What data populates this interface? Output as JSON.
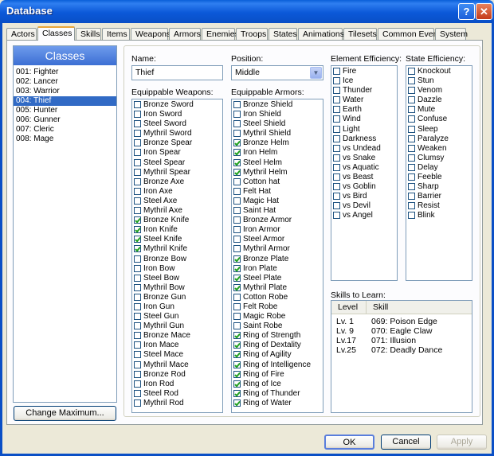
{
  "window": {
    "title": "Database"
  },
  "tabs": [
    "Actors",
    "Classes",
    "Skills",
    "Items",
    "Weapons",
    "Armors",
    "Enemies",
    "Troops",
    "States",
    "Animations",
    "Tilesets",
    "Common Events",
    "System"
  ],
  "classes": {
    "header": "Classes",
    "items": [
      "001: Fighter",
      "002: Lancer",
      "003: Warrior",
      "004: Thief",
      "005: Hunter",
      "006: Gunner",
      "007: Cleric",
      "008: Mage"
    ],
    "selected_index": 3,
    "change_max_label": "Change Maximum..."
  },
  "form": {
    "name_label": "Name:",
    "name_value": "Thief",
    "position_label": "Position:",
    "position_value": "Middle",
    "weapons_label": "Equippable Weapons:",
    "armors_label": "Equippable Armors:",
    "element_label": "Element Efficiency:",
    "state_label": "State Efficiency:",
    "skills_label": "Skills to Learn:"
  },
  "weapons": [
    {
      "name": "Bronze Sword",
      "checked": false
    },
    {
      "name": "Iron Sword",
      "checked": false
    },
    {
      "name": "Steel Sword",
      "checked": false
    },
    {
      "name": "Mythril Sword",
      "checked": false
    },
    {
      "name": "Bronze Spear",
      "checked": false
    },
    {
      "name": "Iron Spear",
      "checked": false
    },
    {
      "name": "Steel Spear",
      "checked": false
    },
    {
      "name": "Mythril Spear",
      "checked": false
    },
    {
      "name": "Bronze Axe",
      "checked": false
    },
    {
      "name": "Iron Axe",
      "checked": false
    },
    {
      "name": "Steel Axe",
      "checked": false
    },
    {
      "name": "Mythril Axe",
      "checked": false
    },
    {
      "name": "Bronze Knife",
      "checked": true
    },
    {
      "name": "Iron Knife",
      "checked": true
    },
    {
      "name": "Steel Knife",
      "checked": true
    },
    {
      "name": "Mythril Knife",
      "checked": true
    },
    {
      "name": "Bronze Bow",
      "checked": false
    },
    {
      "name": "Iron Bow",
      "checked": false
    },
    {
      "name": "Steel Bow",
      "checked": false
    },
    {
      "name": "Mythril Bow",
      "checked": false
    },
    {
      "name": "Bronze Gun",
      "checked": false
    },
    {
      "name": "Iron Gun",
      "checked": false
    },
    {
      "name": "Steel Gun",
      "checked": false
    },
    {
      "name": "Mythril Gun",
      "checked": false
    },
    {
      "name": "Bronze Mace",
      "checked": false
    },
    {
      "name": "Iron Mace",
      "checked": false
    },
    {
      "name": "Steel Mace",
      "checked": false
    },
    {
      "name": "Mythril Mace",
      "checked": false
    },
    {
      "name": "Bronze Rod",
      "checked": false
    },
    {
      "name": "Iron Rod",
      "checked": false
    },
    {
      "name": "Steel Rod",
      "checked": false
    },
    {
      "name": "Mythril Rod",
      "checked": false
    }
  ],
  "armors": [
    {
      "name": "Bronze Shield",
      "checked": false
    },
    {
      "name": "Iron Shield",
      "checked": false
    },
    {
      "name": "Steel Shield",
      "checked": false
    },
    {
      "name": "Mythril Shield",
      "checked": false
    },
    {
      "name": "Bronze Helm",
      "checked": true
    },
    {
      "name": "Iron Helm",
      "checked": true
    },
    {
      "name": "Steel Helm",
      "checked": true
    },
    {
      "name": "Mythril Helm",
      "checked": true
    },
    {
      "name": "Cotton hat",
      "checked": false
    },
    {
      "name": "Felt Hat",
      "checked": false
    },
    {
      "name": "Magic Hat",
      "checked": false
    },
    {
      "name": "Saint Hat",
      "checked": false
    },
    {
      "name": "Bronze Armor",
      "checked": false
    },
    {
      "name": "Iron Armor",
      "checked": false
    },
    {
      "name": "Steel Armor",
      "checked": false
    },
    {
      "name": "Mythril Armor",
      "checked": false
    },
    {
      "name": "Bronze Plate",
      "checked": true
    },
    {
      "name": "Iron Plate",
      "checked": true
    },
    {
      "name": "Steel Plate",
      "checked": true
    },
    {
      "name": "Mythril Plate",
      "checked": true
    },
    {
      "name": "Cotton Robe",
      "checked": false
    },
    {
      "name": "Felt Robe",
      "checked": false
    },
    {
      "name": "Magic Robe",
      "checked": false
    },
    {
      "name": "Saint Robe",
      "checked": false
    },
    {
      "name": "Ring of Strength",
      "checked": true
    },
    {
      "name": "Ring of Dextality",
      "checked": true
    },
    {
      "name": "Ring of Agility",
      "checked": true
    },
    {
      "name": "Ring of Intelligence",
      "checked": true
    },
    {
      "name": "Ring of Fire",
      "checked": true
    },
    {
      "name": "Ring of Ice",
      "checked": true
    },
    {
      "name": "Ring of Thunder",
      "checked": true
    },
    {
      "name": "Ring of Water",
      "checked": true
    }
  ],
  "elements": [
    "Fire",
    "Ice",
    "Thunder",
    "Water",
    "Earth",
    "Wind",
    "Light",
    "Darkness",
    "vs Undead",
    "vs Snake",
    "vs Aquatic",
    "vs Beast",
    "vs Goblin",
    "vs Bird",
    "vs Devil",
    "vs Angel"
  ],
  "states": [
    "Knockout",
    "Stun",
    "Venom",
    "Dazzle",
    "Mute",
    "Confuse",
    "Sleep",
    "Paralyze",
    "Weaken",
    "Clumsy",
    "Delay",
    "Feeble",
    "Sharp",
    "Barrier",
    "Resist",
    "Blink"
  ],
  "skills": {
    "col_level": "Level",
    "col_skill": "Skill",
    "rows": [
      {
        "level": "Lv. 1",
        "skill": "069: Poison Edge"
      },
      {
        "level": "Lv. 9",
        "skill": "070: Eagle Claw"
      },
      {
        "level": "Lv.17",
        "skill": "071: Illusion"
      },
      {
        "level": "Lv.25",
        "skill": "072: Deadly Dance"
      }
    ]
  },
  "footer": {
    "ok": "OK",
    "cancel": "Cancel",
    "apply": "Apply"
  },
  "icons": {
    "help": "help-icon",
    "close": "close-icon",
    "dropdown": "chevron-down-icon"
  }
}
